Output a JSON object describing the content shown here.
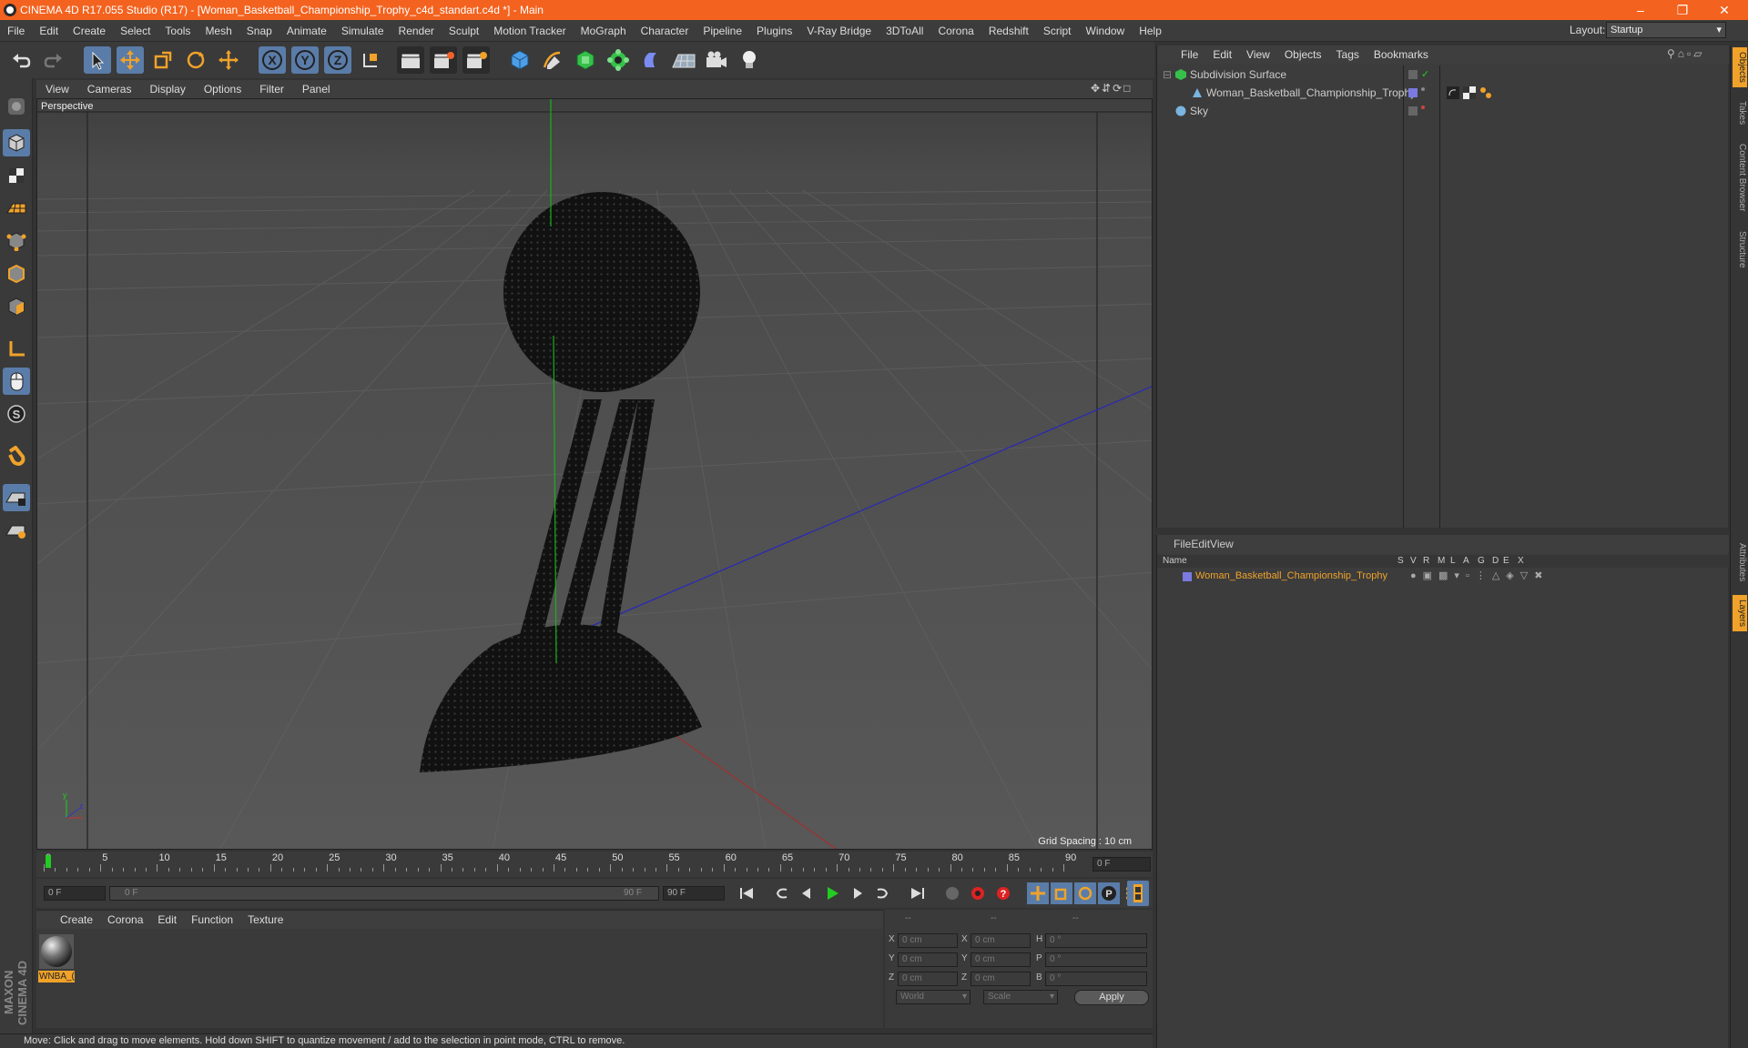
{
  "window": {
    "title": "CINEMA 4D R17.055 Studio (R17) - [Woman_Basketball_Championship_Trophy_c4d_standart.c4d *] - Main"
  },
  "menu": [
    "File",
    "Edit",
    "Create",
    "Select",
    "Tools",
    "Mesh",
    "Snap",
    "Animate",
    "Simulate",
    "Render",
    "Sculpt",
    "Motion Tracker",
    "MoGraph",
    "Character",
    "Pipeline",
    "Plugins",
    "V-Ray Bridge",
    "3DToAll",
    "Corona",
    "Redshift",
    "Script",
    "Window",
    "Help"
  ],
  "layout": {
    "label": "Layout:",
    "value": "Startup"
  },
  "viewport": {
    "menu": [
      "View",
      "Cameras",
      "Display",
      "Options",
      "Filter",
      "Panel"
    ],
    "label": "Perspective",
    "grid_spacing": "Grid Spacing : 10 cm"
  },
  "timeline": {
    "ticks": [
      "0",
      "5",
      "10",
      "15",
      "20",
      "25",
      "30",
      "35",
      "40",
      "45",
      "50",
      "55",
      "60",
      "65",
      "70",
      "75",
      "80",
      "85",
      "90"
    ],
    "end_field": "0 F",
    "start_field": "0 F",
    "range_start": "0 F",
    "range_end": "90 F",
    "max_field": "90 F"
  },
  "materials": {
    "menu": [
      "Create",
      "Corona",
      "Edit",
      "Function",
      "Texture"
    ],
    "items": [
      {
        "name": "WNBA_("
      }
    ]
  },
  "coords": {
    "headers": [
      "--",
      "--",
      "--"
    ],
    "rows": [
      {
        "a": "X",
        "v1": "0 cm",
        "b": "X",
        "v2": "0 cm",
        "c": "H",
        "v3": "0 °"
      },
      {
        "a": "Y",
        "v1": "0 cm",
        "b": "Y",
        "v2": "0 cm",
        "c": "P",
        "v3": "0 °"
      },
      {
        "a": "Z",
        "v1": "0 cm",
        "b": "Z",
        "v2": "0 cm",
        "c": "B",
        "v3": "0 °"
      }
    ],
    "mode1": "World",
    "mode2": "Scale",
    "apply": "Apply"
  },
  "objects": {
    "menu": [
      "File",
      "Edit",
      "View",
      "Objects",
      "Tags",
      "Bookmarks"
    ],
    "items": [
      {
        "name": "Subdivision Surface"
      },
      {
        "name": "Woman_Basketball_Championship_Trophy"
      },
      {
        "name": "Sky"
      }
    ]
  },
  "layers": {
    "menu": [
      "File",
      "Edit",
      "View"
    ],
    "columns": [
      "Name",
      "S",
      "V",
      "R",
      "M",
      "L",
      "A",
      "G",
      "D",
      "E",
      "X"
    ],
    "items": [
      {
        "name": "Woman_Basketball_Championship_Trophy"
      }
    ]
  },
  "right_tabs": [
    "Objects",
    "Takes",
    "Content Browser",
    "Structure",
    "Attributes",
    "Layers"
  ],
  "status": "Move: Click and drag to move elements. Hold down SHIFT to quantize movement / add to the selection in point mode, CTRL to remove.",
  "brand": "MAXON CINEMA 4D",
  "colors": {
    "title_bar": "#f3621e",
    "accent": "#f0a22a",
    "selected_tool": "#5a7ca8"
  }
}
